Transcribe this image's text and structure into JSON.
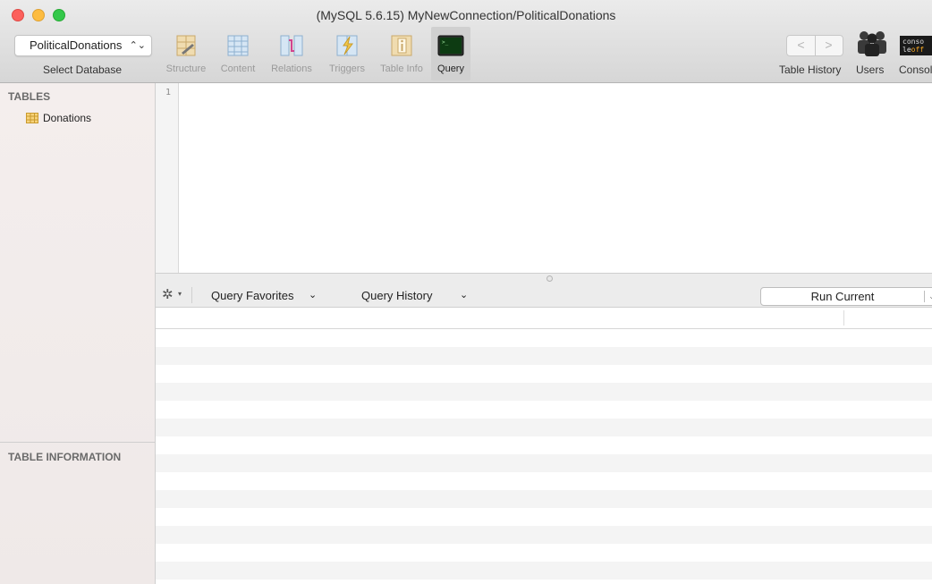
{
  "window": {
    "title": "(MySQL 5.6.15) MyNewConnection/PoliticalDonations"
  },
  "toolbar": {
    "database_select": {
      "value": "PoliticalDonations",
      "label": "Select Database"
    },
    "buttons": [
      {
        "label": "Structure",
        "icon": "structure-icon",
        "active": false
      },
      {
        "label": "Content",
        "icon": "content-icon",
        "active": false
      },
      {
        "label": "Relations",
        "icon": "relations-icon",
        "active": false
      },
      {
        "label": "Triggers",
        "icon": "triggers-icon",
        "active": false
      },
      {
        "label": "Table Info",
        "icon": "table-info-icon",
        "active": false
      },
      {
        "label": "Query",
        "icon": "query-terminal-icon",
        "active": true
      }
    ],
    "right": {
      "back_glyph": "<",
      "forward_glyph": ">",
      "table_history_label": "Table History",
      "users_label": "Users",
      "console_label": "Consol",
      "console_icon_line1": "conso",
      "console_icon_line2a": "le",
      "console_icon_line2b": "off"
    }
  },
  "sidebar": {
    "tables_header": "TABLES",
    "tables": [
      {
        "name": "Donations",
        "icon": "table-icon"
      }
    ],
    "table_info_header": "TABLE INFORMATION"
  },
  "editor": {
    "line_numbers": [
      "1"
    ],
    "content": ""
  },
  "query_bar": {
    "gear_glyph": "✲",
    "favorites_label": "Query Favorites",
    "history_label": "Query History",
    "run_label": "Run Current"
  },
  "colors": {
    "active_tab_bg": "#d0d0d0",
    "sidebar_bg": "#f2eceb",
    "stripe": "#f4f4f4"
  }
}
